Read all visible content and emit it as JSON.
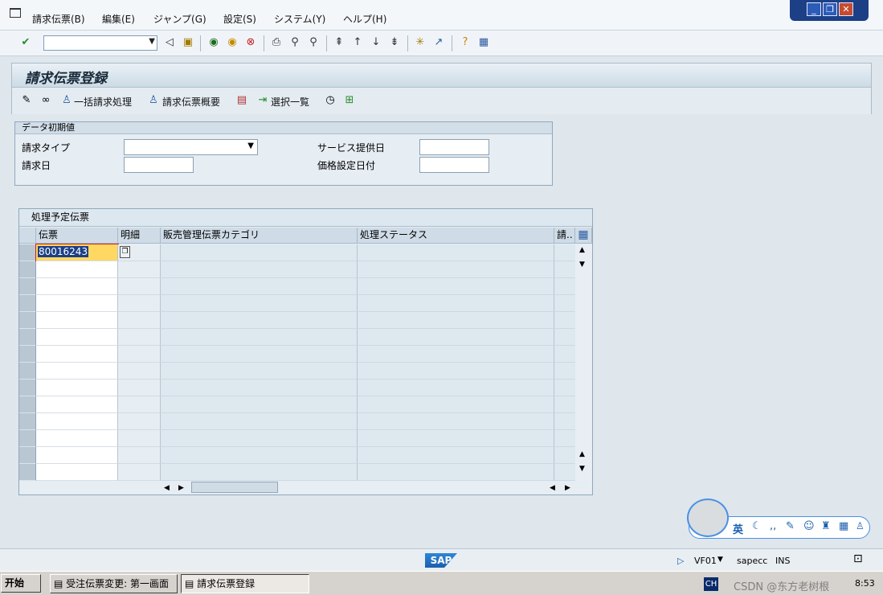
{
  "menubar": {
    "items": [
      "請求伝票(B)",
      "編集(E)",
      "ジャンプ(G)",
      "設定(S)",
      "システム(Y)",
      "ヘルプ(H)"
    ]
  },
  "window_controls": {
    "minimize": "_",
    "restore": "❐",
    "close": "✕"
  },
  "toolbar": {
    "command_field_value": "",
    "icons": [
      "enter-icon",
      "back-nav-icon",
      "save-icon",
      "back-icon",
      "exit-icon",
      "cancel-icon",
      "print-icon",
      "find-icon",
      "find-next-icon",
      "first-page-icon",
      "prev-page-icon",
      "next-page-icon",
      "last-page-icon",
      "create-session-icon",
      "shortcut-icon",
      "help-icon",
      "layout-icon"
    ]
  },
  "title": "請求伝票登録",
  "app_toolbar": {
    "buttons": [
      "一括請求処理",
      "請求伝票概要",
      "選択一覧"
    ]
  },
  "data_group": {
    "title": "データ初期値",
    "fields": {
      "billing_type_label": "請求タイプ",
      "billing_type_value": "",
      "billing_date_label": "請求日",
      "billing_date_value": "",
      "service_date_label": "サービス提供日",
      "service_date_value": "",
      "pricing_date_label": "価格設定日付",
      "pricing_date_value": ""
    }
  },
  "table": {
    "title": "処理予定伝票",
    "columns": [
      "伝票",
      "明細",
      "販売管理伝票カテゴリ",
      "処理ステータス",
      "請.."
    ],
    "rows": [
      {
        "doc": "80016243",
        "item": "",
        "category": "",
        "status": ""
      },
      {
        "doc": "",
        "item": "",
        "category": "",
        "status": ""
      },
      {
        "doc": "",
        "item": "",
        "category": "",
        "status": ""
      },
      {
        "doc": "",
        "item": "",
        "category": "",
        "status": ""
      },
      {
        "doc": "",
        "item": "",
        "category": "",
        "status": ""
      },
      {
        "doc": "",
        "item": "",
        "category": "",
        "status": ""
      },
      {
        "doc": "",
        "item": "",
        "category": "",
        "status": ""
      },
      {
        "doc": "",
        "item": "",
        "category": "",
        "status": ""
      },
      {
        "doc": "",
        "item": "",
        "category": "",
        "status": ""
      },
      {
        "doc": "",
        "item": "",
        "category": "",
        "status": ""
      },
      {
        "doc": "",
        "item": "",
        "category": "",
        "status": ""
      },
      {
        "doc": "",
        "item": "",
        "category": "",
        "status": ""
      },
      {
        "doc": "",
        "item": "",
        "category": "",
        "status": ""
      },
      {
        "doc": "",
        "item": "",
        "category": "",
        "status": ""
      }
    ]
  },
  "statusbar": {
    "logo": "SAP",
    "transaction": "VF01",
    "server": "sapecc",
    "mode": "INS"
  },
  "taskbar": {
    "start_label": "开始",
    "tasks": [
      "受注伝票変更: 第一画面",
      "請求伝票登録"
    ],
    "lang": "CH",
    "clock": "8:53",
    "watermark": "CSDN @东方老树根"
  },
  "ime": {
    "mode": "英"
  },
  "colors": {
    "title_bar": "#1c3f86",
    "sap_blue": "#1a5fae",
    "selected_field": "#ffd862"
  }
}
